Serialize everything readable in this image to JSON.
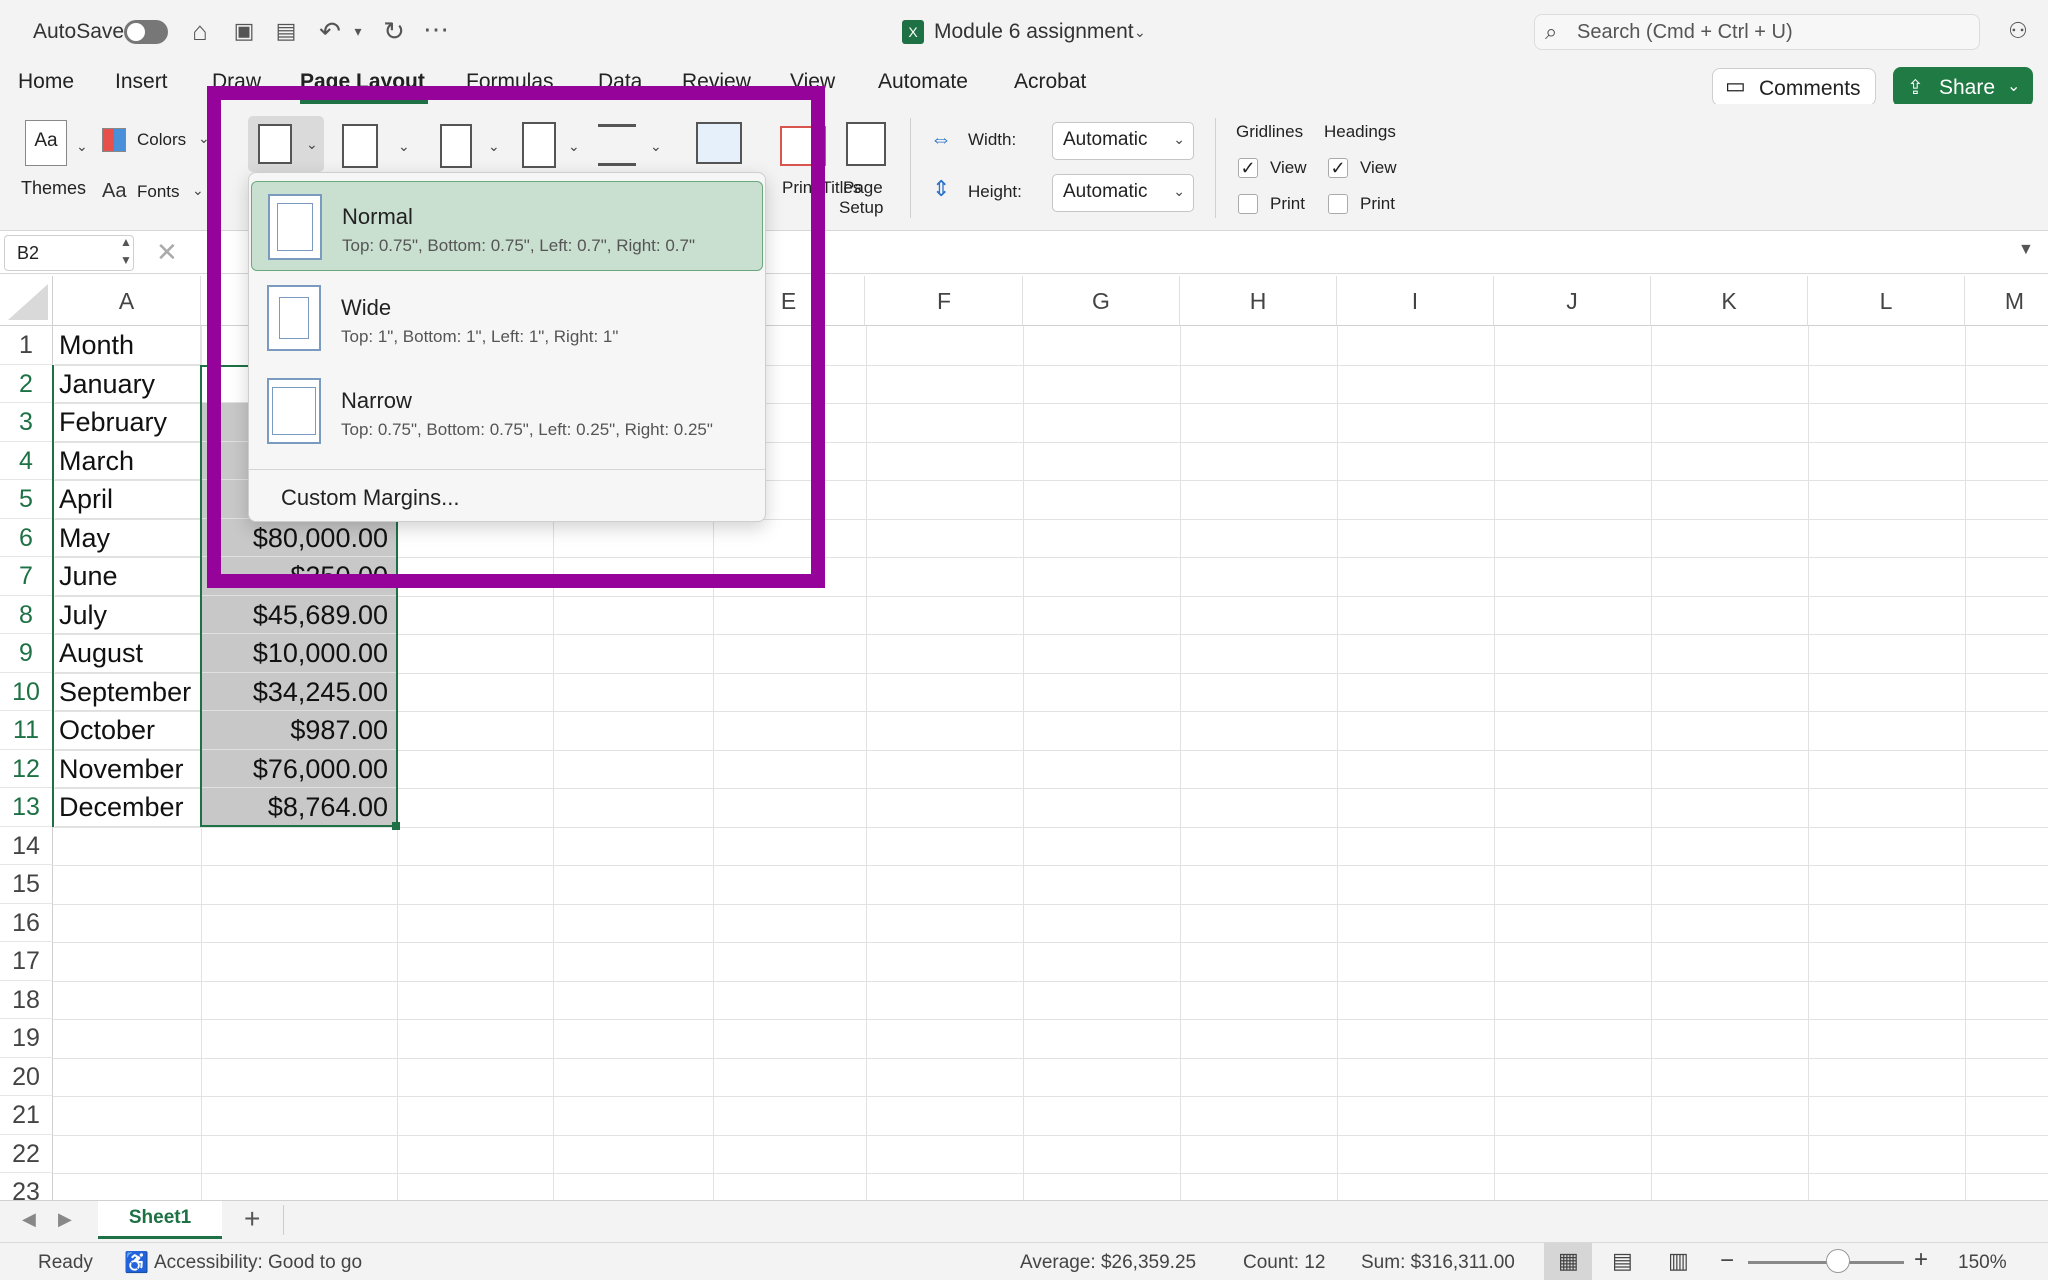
{
  "titlebar": {
    "autosave_label": "AutoSave",
    "doc_title": "Module 6 assignment",
    "search_placeholder": "Search (Cmd + Ctrl + U)"
  },
  "tabs": [
    "Home",
    "Insert",
    "Draw",
    "Page Layout",
    "Formulas",
    "Data",
    "Review",
    "View",
    "Automate",
    "Acrobat"
  ],
  "active_tab": "Page Layout",
  "buttons": {
    "comments": "Comments",
    "share": "Share"
  },
  "ribbon": {
    "themes": "Themes",
    "colors": "Colors",
    "fonts": "Fonts",
    "print_titles": "Print Titles",
    "page_setup_1": "Page",
    "page_setup_2": "Setup",
    "width_label": "Width:",
    "width_value": "Automatic",
    "height_label": "Height:",
    "height_value": "Automatic",
    "gridlines": "Gridlines",
    "headings": "Headings",
    "view": "View",
    "print": "Print"
  },
  "namebox": "B2",
  "margins_menu": {
    "options": [
      {
        "title": "Normal",
        "desc": "Top: 0.75\", Bottom: 0.75\", Left: 0.7\", Right: 0.7\""
      },
      {
        "title": "Wide",
        "desc": "Top: 1\", Bottom: 1\", Left: 1\", Right: 1\""
      },
      {
        "title": "Narrow",
        "desc": "Top: 0.75\", Bottom: 0.75\", Left: 0.25\", Right: 0.25\""
      }
    ],
    "custom": "Custom Margins..."
  },
  "columns": [
    "A",
    "E",
    "F",
    "G",
    "H",
    "I",
    "J",
    "K",
    "L",
    "M"
  ],
  "rows": [
    "1",
    "2",
    "3",
    "4",
    "5",
    "6",
    "7",
    "8",
    "9",
    "10",
    "11",
    "12",
    "13",
    "14",
    "15",
    "16",
    "17",
    "18",
    "19",
    "20",
    "21",
    "22",
    "23"
  ],
  "sheet": {
    "col_a": [
      "Month",
      "January",
      "February",
      "March",
      "April",
      "May",
      "June",
      "July",
      "August",
      "September",
      "October",
      "November",
      "December"
    ],
    "col_b_visible": {
      "6": "$80,000.00",
      "7": "$250.00",
      "8": "$45,689.00",
      "9": "$10,000.00",
      "10": "$34,245.00",
      "11": "$987.00",
      "12": "$76,000.00",
      "13": "$8,764.00"
    }
  },
  "sheet_tab": "Sheet1",
  "status": {
    "ready": "Ready",
    "accessibility": "Accessibility: Good to go",
    "average": "Average: $26,359.25",
    "count": "Count: 12",
    "sum": "Sum: $316,311.00",
    "zoom": "150%"
  },
  "colors": {
    "accent_green": "#1e7145",
    "highlight_purple": "#96039b",
    "share_green": "#1f7a44"
  }
}
